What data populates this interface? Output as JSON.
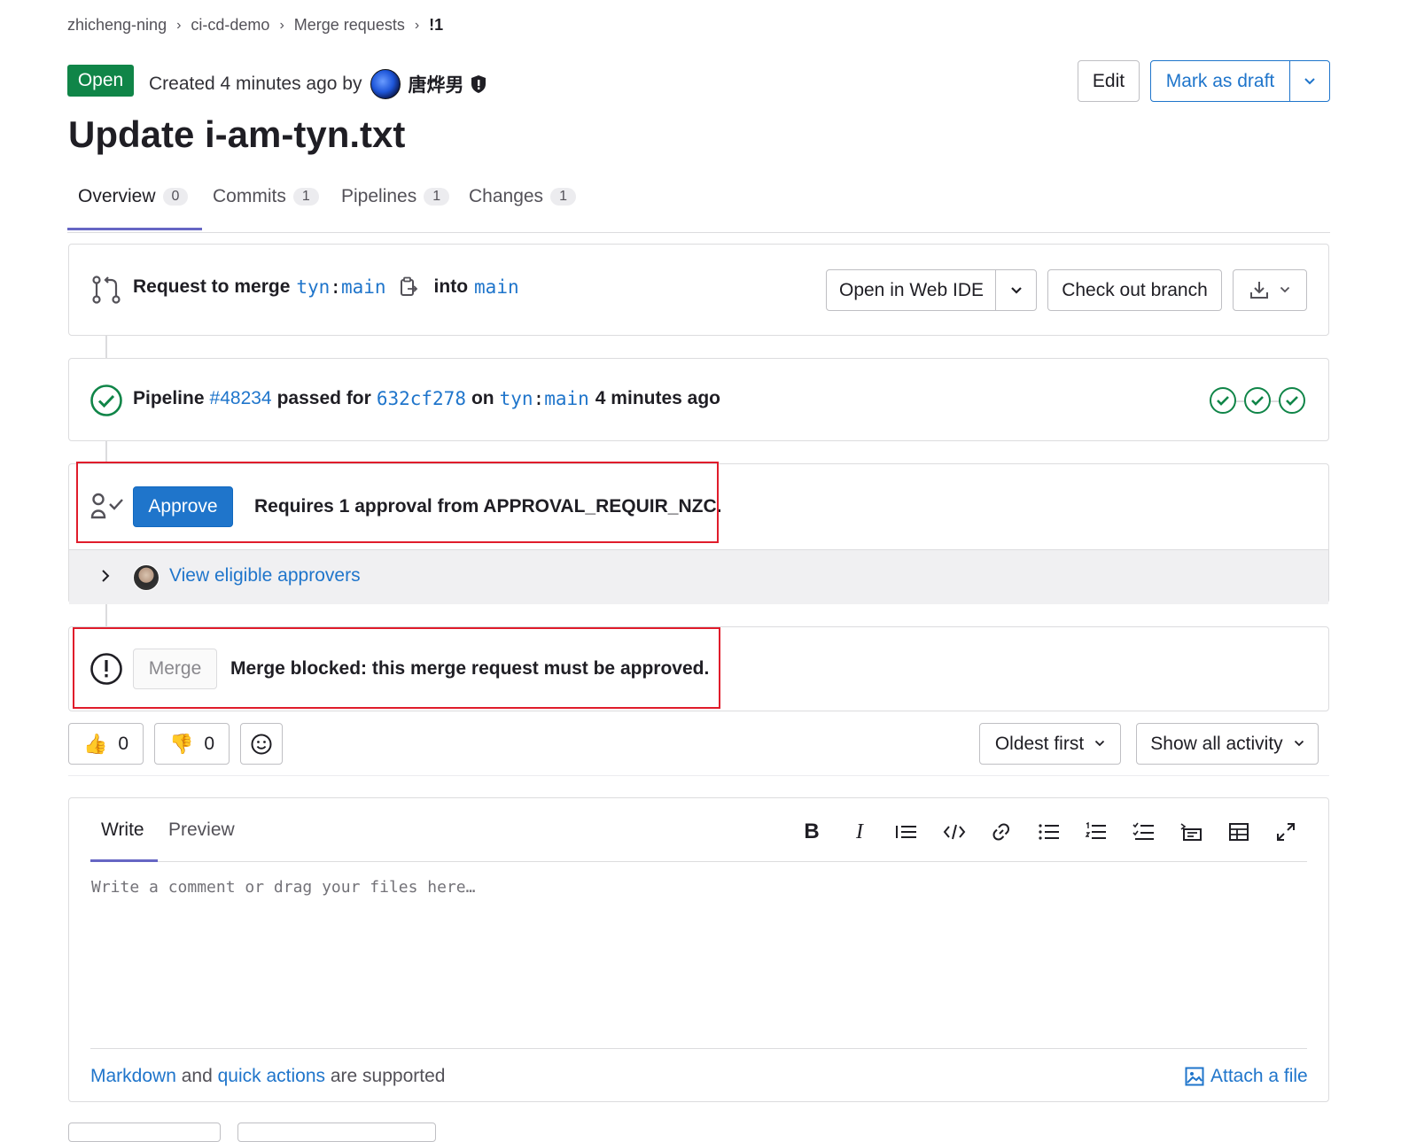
{
  "breadcrumb": [
    "zhicheng-ning",
    "ci-cd-demo",
    "Merge requests",
    "!1"
  ],
  "header": {
    "status": "Open",
    "created_text": "Created 4 minutes ago by",
    "author": "唐烨男",
    "edit_label": "Edit",
    "mark_draft_label": "Mark as draft",
    "title": "Update i-am-tyn.txt"
  },
  "tabs": [
    {
      "label": "Overview",
      "count": "0"
    },
    {
      "label": "Commits",
      "count": "1"
    },
    {
      "label": "Pipelines",
      "count": "1"
    },
    {
      "label": "Changes",
      "count": "1"
    }
  ],
  "merge_info": {
    "prefix": "Request to merge",
    "source_ns": "tyn",
    "source_branch": "main",
    "into": "into",
    "target_branch": "main",
    "open_ide": "Open in Web IDE",
    "checkout": "Check out branch"
  },
  "pipeline": {
    "label": "Pipeline",
    "id": "#48234",
    "passed_for": "passed for",
    "commit": "632cf278",
    "on": "on",
    "ns": "tyn",
    "branch": "main",
    "time": "4 minutes ago",
    "stages": [
      "passed",
      "passed",
      "passed"
    ]
  },
  "approval": {
    "button": "Approve",
    "requirement": "Requires 1 approval from APPROVAL_REQUIR_NZC.",
    "view_approvers": "View eligible approvers"
  },
  "merge": {
    "button": "Merge",
    "blocked_text": "Merge blocked: this merge request must be approved."
  },
  "reactions": {
    "thumbs_up": "0",
    "thumbs_down": "0",
    "sort": "Oldest first",
    "filter": "Show all activity"
  },
  "editor": {
    "tab_write": "Write",
    "tab_preview": "Preview",
    "placeholder": "Write a comment or drag your files here…",
    "markdown": "Markdown",
    "and": "and",
    "quick_actions": "quick actions",
    "supported": "are supported",
    "attach": "Attach a file"
  },
  "colors": {
    "success": "#108548",
    "link": "#1f75cb",
    "highlight": "#e01c2b",
    "tab_accent": "#6666c4"
  }
}
